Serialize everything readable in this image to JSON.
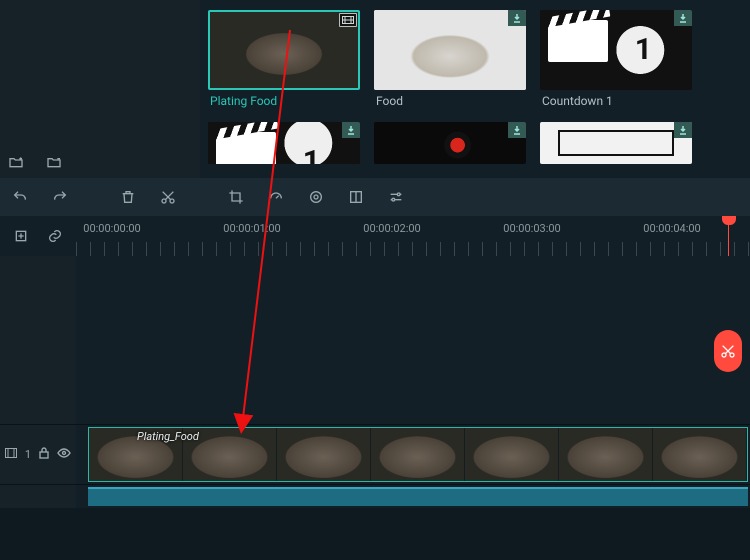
{
  "library": {
    "clips": [
      {
        "id": "plating-food",
        "label": "Plating Food",
        "selected": true,
        "badge": "film",
        "thumb": "food-bowl"
      },
      {
        "id": "food",
        "label": "Food",
        "selected": false,
        "badge": "download",
        "thumb": "food-bowl-light"
      },
      {
        "id": "countdown-1",
        "label": "Countdown 1",
        "selected": false,
        "badge": "download",
        "thumb": "countdown1"
      },
      {
        "id": "countdown-2",
        "label": "",
        "selected": false,
        "badge": "download",
        "thumb": "clap-dark",
        "row": 2
      },
      {
        "id": "countdown-3",
        "label": "",
        "selected": false,
        "badge": "download",
        "thumb": "countdown2",
        "row": 2
      },
      {
        "id": "countdown-4",
        "label": "",
        "selected": false,
        "badge": "download",
        "thumb": "countdown3",
        "row": 2
      }
    ]
  },
  "toolbar": {
    "undo": "Undo",
    "redo": "Redo",
    "delete": "Delete",
    "cut": "Cut",
    "crop": "Crop",
    "speed": "Speed",
    "color": "Color",
    "green_screen": "Green Screen",
    "adjust": "Adjust"
  },
  "ruler": {
    "add_marker": "Add marker",
    "link": "Link",
    "labels": [
      "00:00:00:00",
      "00:00:01:00",
      "00:00:02:00",
      "00:00:03:00",
      "00:00:04:00"
    ],
    "playhead_t": "00:00:04:15"
  },
  "timeline": {
    "video_track": {
      "index": "1",
      "clip_label": "Plating_Food",
      "frame_count": 7
    },
    "lock": "Lock",
    "visible": "Visible"
  },
  "colors": {
    "accent": "#29c7b8",
    "playhead": "#ff4a3d"
  }
}
